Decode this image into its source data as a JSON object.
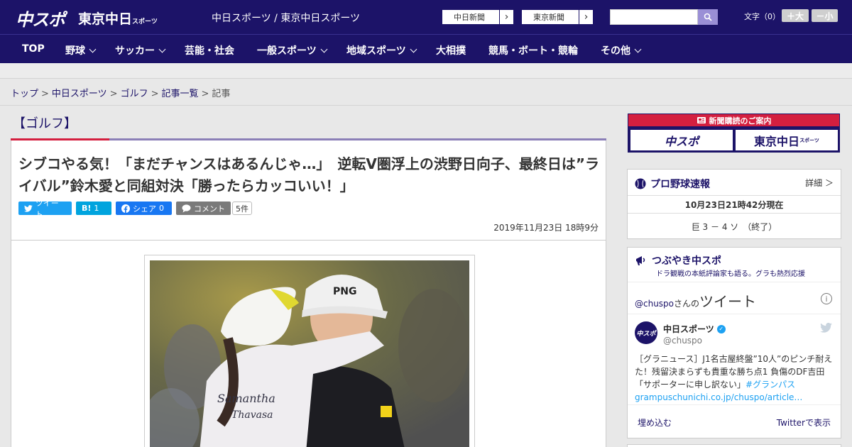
{
  "header": {
    "logo_chuspo": "中スポ",
    "logo_tokyo": "東京中日",
    "logo_tokyo_small": "スポーツ",
    "site_title": "中日スポーツ / 東京中日スポーツ",
    "chunichi_shimbun": "中日新聞",
    "tokyo_shimbun": "東京新聞",
    "search_placeholder": "",
    "font_size_label": "文字（0）",
    "font_bigger": "＋大",
    "font_smaller": "－小"
  },
  "nav": {
    "items": [
      {
        "label": "TOP"
      },
      {
        "label": "野球"
      },
      {
        "label": "サッカー"
      },
      {
        "label": "芸能・社会"
      },
      {
        "label": "一般スポーツ"
      },
      {
        "label": "地域スポーツ"
      },
      {
        "label": "大相撲"
      },
      {
        "label": "競馬・ボート・競輪"
      },
      {
        "label": "その他"
      }
    ]
  },
  "breadcrumb": {
    "items": [
      "トップ",
      "中日スポーツ",
      "ゴルフ",
      "記事一覧"
    ],
    "current": "記事",
    "separator": ">"
  },
  "article": {
    "category": "【ゴルフ】",
    "headline": "シブコやる気！「まだチャンスはあるんじゃ…」　逆転V圏浮上の渋野日向子、最終日は”ライバル”鈴木愛と同組対決「勝ったらカッコいい！」",
    "share": {
      "tweet": "ツイート",
      "hatena": "B!",
      "hatena_count": "1",
      "facebook": "シェア",
      "facebook_count": "0",
      "comment": "コメント",
      "comment_count": "5件"
    },
    "date": "2019年11月23日 18時9分"
  },
  "sidebar": {
    "ad": {
      "head": "新聞購読のご案内",
      "logo1": "中スポ",
      "logo2": "東京中日",
      "logo2_small": "スポーツ"
    },
    "baseball": {
      "title": "プロ野球速報",
      "detail": "詳細 ＞",
      "time": "10月23日21時42分現在",
      "result": "巨 3 － 4 ソ　（終了）"
    },
    "twitter": {
      "title": "つぶやき中スポ",
      "subtitle": "ドラ観戦の本紙評論家も語る。グラも熱烈応援",
      "handle": "@chuspo",
      "handle_suffix": "さんの",
      "heading": "ツイート",
      "account_name": "中日スポーツ",
      "account_user": "@chuspo",
      "avatar_text": "中スポ",
      "tweet_text": "［グラニュース］J1名古屋終盤”10人”のピンチ耐えた！残留決まらずも貴重な勝ち点1 負傷のDF吉田「サポーターに申し訳ない」",
      "tweet_tag": "#グランパス",
      "tweet_link": "grampuschunichi.co.jp/chuspo/article…",
      "embed": "埋め込む",
      "view": "Twitterで表示"
    }
  },
  "colors": {
    "brand_navy": "#1c1368",
    "accent_red": "#d41f3f",
    "twitter_blue": "#1da1f2"
  }
}
